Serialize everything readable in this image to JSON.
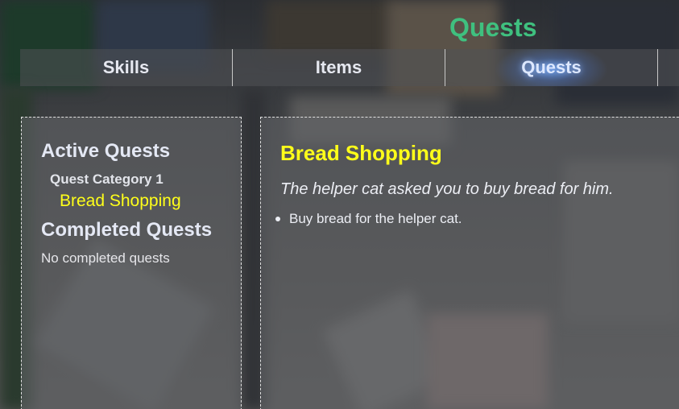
{
  "page_title": "Quests",
  "tabs": [
    {
      "label": "Skills",
      "active": false
    },
    {
      "label": "Items",
      "active": false
    },
    {
      "label": "Quests",
      "active": true
    }
  ],
  "quest_list": {
    "active_heading": "Active Quests",
    "category": "Quest Category 1",
    "active_quests": [
      "Bread Shopping"
    ],
    "completed_heading": "Completed Quests",
    "completed_empty": "No completed quests"
  },
  "quest_detail": {
    "title": "Bread Shopping",
    "description": "The helper cat asked you to buy bread for him.",
    "objectives": [
      "Buy bread for the helper cat."
    ]
  },
  "colors": {
    "title_green": "#3fc07f",
    "quest_yellow": "#ffff1a",
    "active_tab_glow": "#64a0ff"
  }
}
